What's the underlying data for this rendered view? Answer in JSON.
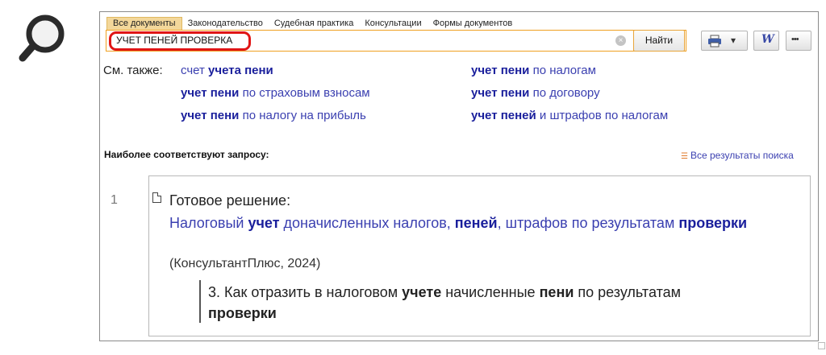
{
  "tabs": [
    "Все документы",
    "Законодательство",
    "Судебная практика",
    "Консультации",
    "Формы документов"
  ],
  "search": {
    "value": "УЧЕТ ПЕНЕЙ ПРОВЕРКА",
    "clear_icon": "×"
  },
  "find_button": "Найти",
  "toolbar": {
    "print_icon": "printer-icon",
    "dropdown_icon": "▾",
    "word_label": "W",
    "more_label": "•••"
  },
  "see_also": {
    "label": "См. также:",
    "links": [
      {
        "parts": [
          {
            "t": "счет ",
            "b": false
          },
          {
            "t": "учета пени",
            "b": true
          }
        ]
      },
      {
        "parts": [
          {
            "t": "учет пени",
            "b": true
          },
          {
            "t": " по страховым взносам",
            "b": false
          }
        ]
      },
      {
        "parts": [
          {
            "t": "учет пени",
            "b": true
          },
          {
            "t": " по налогу на прибыль",
            "b": false
          }
        ]
      },
      {
        "parts": [
          {
            "t": "учет пени",
            "b": true
          },
          {
            "t": " по налогам",
            "b": false
          }
        ]
      },
      {
        "parts": [
          {
            "t": "учет пени",
            "b": true
          },
          {
            "t": " по договору",
            "b": false
          }
        ]
      },
      {
        "parts": [
          {
            "t": "учет пеней",
            "b": true
          },
          {
            "t": " и штрафов по налогам",
            "b": false
          }
        ]
      }
    ]
  },
  "best_match_heading": "Наиболее соответствуют запросу:",
  "all_results_link": "Все результаты поиска",
  "result": {
    "number": "1",
    "type": "Готовое решение:",
    "title_parts": [
      {
        "t": "Налоговый ",
        "b": false
      },
      {
        "t": "учет",
        "b": true
      },
      {
        "t": " доначисленных налогов, ",
        "b": false
      },
      {
        "t": "пеней",
        "b": true
      },
      {
        "t": ", штрафов по результатам ",
        "b": false
      },
      {
        "t": "проверки",
        "b": true
      }
    ],
    "source": "(КонсультантПлюс, 2024)",
    "snippet_parts": [
      {
        "t": "3. Как отразить в налоговом ",
        "b": false
      },
      {
        "t": "учете",
        "b": true
      },
      {
        "t": " начисленные ",
        "b": false
      },
      {
        "t": "пени",
        "b": true
      },
      {
        "t": " по результатам ",
        "b": false
      },
      {
        "t": "проверки",
        "b": true
      }
    ]
  },
  "colors": {
    "link": "#3a3fb0",
    "highlight": "#e01515",
    "accent": "#f0a020",
    "active_tab": "#f3d79a"
  }
}
